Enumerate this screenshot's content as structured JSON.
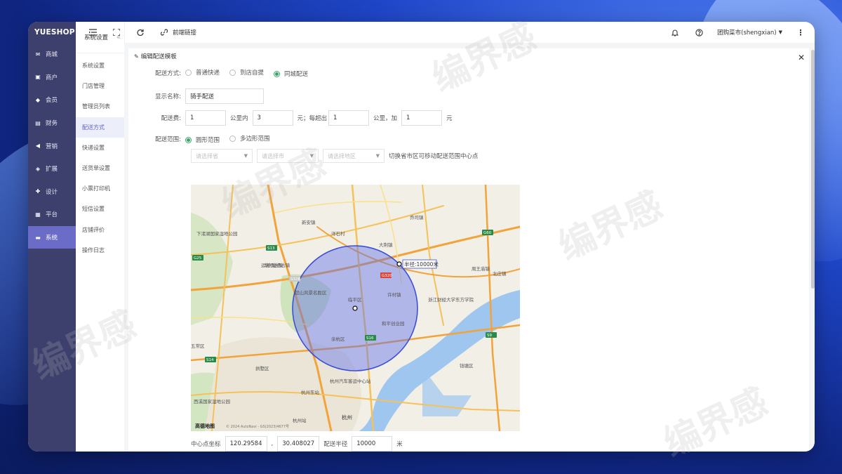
{
  "brand": "YUESHOP",
  "nav_primary": [
    {
      "label": "商城",
      "icon": "mail-icon"
    },
    {
      "label": "商户",
      "icon": "shop-icon"
    },
    {
      "label": "会员",
      "icon": "member-icon"
    },
    {
      "label": "财务",
      "icon": "finance-icon"
    },
    {
      "label": "营销",
      "icon": "megaphone-icon"
    },
    {
      "label": "扩展",
      "icon": "cube-icon"
    },
    {
      "label": "设计",
      "icon": "puzzle-icon"
    },
    {
      "label": "平台",
      "icon": "grid-icon"
    },
    {
      "label": "系统",
      "icon": "system-icon"
    }
  ],
  "nav_primary_active": 8,
  "nav_secondary": {
    "title": "系统设置",
    "items": [
      "系统设置",
      "门店管理",
      "管理员列表",
      "配送方式",
      "快递设置",
      "送货单设置",
      "小票打印机",
      "短信设置",
      "店铺评价",
      "操作日志"
    ],
    "active": 3
  },
  "topbar": {
    "front_link": "前端链接",
    "user": "团购菜市(shengxian)"
  },
  "panel_title": "编辑配送模板",
  "form": {
    "delivery_method_label": "配送方式:",
    "delivery_methods": [
      "普通快递",
      "到店自提",
      "同城配送"
    ],
    "delivery_method_selected": 2,
    "display_name_label": "显示名称:",
    "display_name_value": "骑手配送",
    "fee_label": "配送费:",
    "fee_base": "1",
    "fee_text1": "公里内",
    "fee_km": "3",
    "fee_text2": "元；每超出",
    "fee_extra_km": "1",
    "fee_text3": "公里，加",
    "fee_extra": "1",
    "fee_text4": "元",
    "range_label": "配送范围:",
    "range_types": [
      "圆形范围",
      "多边形范围"
    ],
    "range_selected": 0,
    "province_placeholder": "请选择省",
    "city_placeholder": "请选择市",
    "district_placeholder": "请选择地区",
    "region_hint": "切换省市区可移动配送范围中心点",
    "center_label": "中心点坐标",
    "lng": "120.295847",
    "lat": "30.408027",
    "comma": ",",
    "radius_label": "配送半径",
    "radius_value": "10000",
    "radius_unit": "米"
  },
  "map": {
    "radius_tag": "半径:10000米",
    "labels": [
      "杭州",
      "余杭区",
      "临平区",
      "和平创业园",
      "浙江财经大学东方学院",
      "杭州汽车客运中心站",
      "杭州东站",
      "钱塘区",
      "超山风景名胜区",
      "西溪国家湿地公园",
      "下渚湖国家湿地公园",
      "新安镇",
      "洋石村",
      "乔司镇",
      "北庄镇",
      "大荆镇",
      "许村镇",
      "周王庙镇",
      "塘栖古镇",
      "拱墅区",
      "运河·塘栖古镇",
      "杭州站",
      "五常区"
    ],
    "road_tags": [
      "S13",
      "G320",
      "S16",
      "S14",
      "S9",
      "G60",
      "G25",
      "S326"
    ],
    "logo": "高德地图",
    "copyright": "© 2024 AutoNavi - GS(2023)4677号"
  },
  "watermark": "编界感",
  "colors": {
    "sidebar": "#3d3f6d",
    "active": "#6a6cc8",
    "radio": "#3aa56a",
    "circle": "#6070e8"
  }
}
